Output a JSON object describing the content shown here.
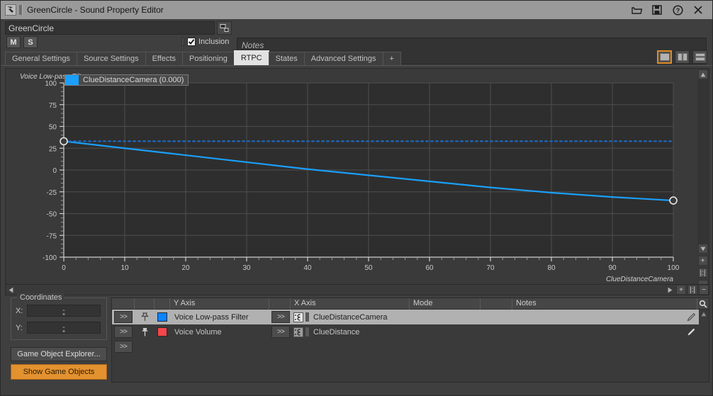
{
  "window": {
    "title": "GreenCircle - Sound Property Editor",
    "app_icon": "wwise-icon",
    "buttons": [
      {
        "name": "open-folder-icon",
        "label": "Open"
      },
      {
        "name": "save-icon",
        "label": "Save"
      },
      {
        "name": "help-icon",
        "label": "Help"
      },
      {
        "name": "close-icon",
        "label": "Close"
      }
    ]
  },
  "header": {
    "object_name": "GreenCircle",
    "object_name_placeholder": "Name",
    "browse_icon": "object-browser-icon",
    "mute_label": "M",
    "solo_label": "S",
    "inclusion_label": "Inclusion",
    "inclusion_checked": "✔",
    "notes_placeholder": "Notes",
    "notes_value": ""
  },
  "tabs": {
    "items": [
      {
        "label": "General Settings",
        "active": false
      },
      {
        "label": "Source Settings",
        "active": false
      },
      {
        "label": "Effects",
        "active": false
      },
      {
        "label": "Positioning",
        "active": false
      },
      {
        "label": "RTPC",
        "active": true
      },
      {
        "label": "States",
        "active": false
      },
      {
        "label": "Advanced Settings",
        "active": false
      },
      {
        "label": "+",
        "active": false
      }
    ],
    "layout_buttons": [
      {
        "name": "layout-single-view-button",
        "active": true
      },
      {
        "name": "layout-split-vertical-button",
        "active": false
      },
      {
        "name": "layout-split-horizontal-button",
        "active": false
      }
    ]
  },
  "graph": {
    "y_axis_title": "Voice Low-pass Filter",
    "legend_label": "ClueDistanceCamera (0.000)",
    "legend_color": "#1a9ffa",
    "zoom_buttons": [
      "+",
      "|:|",
      "−"
    ],
    "scroll_left_arrow": "◀",
    "scroll_right_arrow": "▶",
    "scroll_up_arrow": "▲",
    "scroll_down_arrow": "▼"
  },
  "chart_data": {
    "type": "line",
    "title": "",
    "xlabel": "ClueDistanceCamera",
    "ylabel": "Voice Low-pass Filter",
    "xlim": [
      0,
      100
    ],
    "ylim": [
      -100,
      100
    ],
    "xticks": [
      0,
      10,
      20,
      30,
      40,
      50,
      60,
      70,
      80,
      90,
      100
    ],
    "yticks": [
      100,
      75,
      50,
      25,
      0,
      -25,
      -50,
      -75,
      -100
    ],
    "grid": true,
    "legend": "ClueDistanceCamera (0.000)",
    "series": [
      {
        "name": "Voice Low-pass Filter",
        "color": "#1a9ffa",
        "style": "solid",
        "points": [
          {
            "x": 0,
            "y": 33
          },
          {
            "x": 10,
            "y": 25
          },
          {
            "x": 20,
            "y": 17
          },
          {
            "x": 30,
            "y": 9
          },
          {
            "x": 40,
            "y": 1
          },
          {
            "x": 50,
            "y": -6
          },
          {
            "x": 60,
            "y": -13
          },
          {
            "x": 70,
            "y": -20
          },
          {
            "x": 80,
            "y": -26
          },
          {
            "x": 90,
            "y": -31
          },
          {
            "x": 100,
            "y": -35
          }
        ],
        "control_points": [
          {
            "x": 0,
            "y": 33
          },
          {
            "x": 100,
            "y": -35
          }
        ]
      },
      {
        "name": "current-value-line",
        "color": "#1a6fd0",
        "style": "dotted",
        "points": [
          {
            "x": 0,
            "y": 33
          },
          {
            "x": 100,
            "y": 33
          }
        ]
      }
    ]
  },
  "coordinates": {
    "title": "Coordinates",
    "x_label": "X:",
    "x_value": "-",
    "y_label": "Y:",
    "y_value": "-",
    "explorer_button": "Game Object Explorer...",
    "show_game_objects_button": "Show Game Objects",
    "show_game_objects_color": "#e4922f"
  },
  "table": {
    "columns": [
      "",
      "",
      "",
      "Y Axis",
      "",
      "X Axis",
      "Mode",
      "",
      "Notes",
      ""
    ],
    "search_icon": "search-icon",
    "rows": [
      {
        "arrows_label": ">>",
        "pin_icon": "pin-unpinned-icon",
        "color": "#0a84ff",
        "y_axis": "Voice Low-pass Filter",
        "x_arrows_label": ">>",
        "rtpc_icon": "game-parameter-icon",
        "x_axis": "ClueDistanceCamera",
        "mode": "",
        "notes": "",
        "edit_icon": "pencil-icon",
        "selected": true
      },
      {
        "arrows_label": ">>",
        "pin_icon": "pin-pinned-icon",
        "color": "#f8464b",
        "y_axis": "Voice Volume",
        "x_arrows_label": ">>",
        "rtpc_icon": "game-parameter-icon",
        "x_axis": "ClueDistance",
        "mode": "",
        "notes": "",
        "edit_icon": "pencil-icon",
        "selected": false
      },
      {
        "arrows_label": ">>",
        "pin_icon": "",
        "color": "",
        "y_axis": "",
        "x_arrows_label": "",
        "rtpc_icon": "",
        "x_axis": "",
        "mode": "",
        "notes": "",
        "edit_icon": "",
        "selected": false
      }
    ]
  }
}
